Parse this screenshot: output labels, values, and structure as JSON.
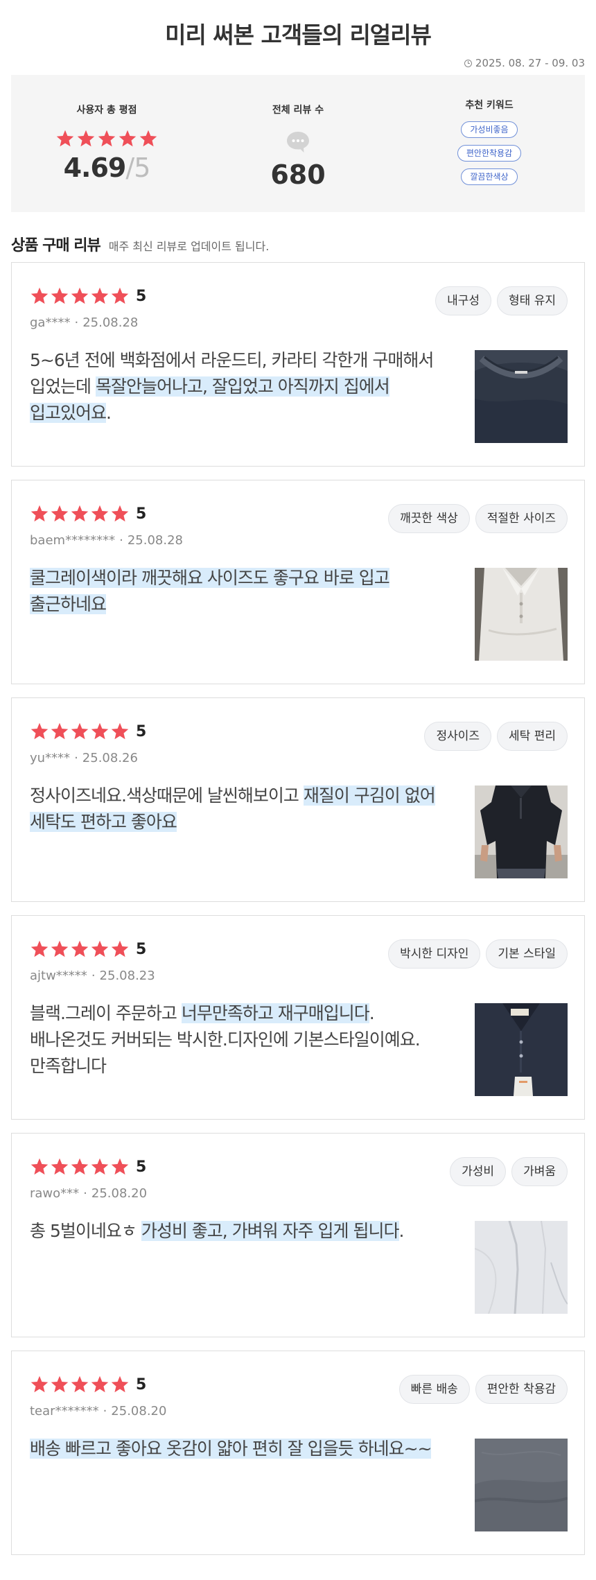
{
  "header": {
    "title": "미리 써본 고객들의 리얼리뷰",
    "period": "2025. 08. 27 - 09. 03"
  },
  "summary": {
    "rating_label": "사용자 총 평점",
    "rating_value": "4.69",
    "rating_slash": "/",
    "rating_max": "5",
    "rating_stars": 5,
    "count_label": "전체 리뷰 수",
    "count_value": "680",
    "keyword_label": "추천 키워드",
    "keywords": [
      "가성비좋음",
      "편안한착용감",
      "깔끔한색상"
    ]
  },
  "section": {
    "title": "상품 구매 리뷰",
    "subtitle": "매주 최신 리뷰로 업데이트 됩니다."
  },
  "colors": {
    "star": "#ef4f58",
    "highlight": "#d9ecfb",
    "keyword": "#3d63c9"
  },
  "reviews": [
    {
      "score": "5",
      "user": "ga****",
      "date": "25.08.28",
      "tags": [
        "내구성",
        "형태 유지"
      ],
      "text_plain": "5~6년 전에 백화점에서 라운드티, 카라티 각한개 구매해서 입었는데 ",
      "text_highlight": "목잘안늘어나고, 잘입었고 아직까지 집에서 입고있어요",
      "text_after": ".",
      "image": "dark-navy-tshirt-closeup"
    },
    {
      "score": "5",
      "user": "baem********",
      "date": "25.08.28",
      "tags": [
        "깨끗한 색상",
        "적절한 사이즈"
      ],
      "text_plain": "",
      "text_highlight": "쿨그레이색이라 깨끗해요 사이즈도 좋구요 바로 입고 출근하네요",
      "text_after": "",
      "image": "light-gray-polo"
    },
    {
      "score": "5",
      "user": "yu****",
      "date": "25.08.26",
      "tags": [
        "정사이즈",
        "세탁 편리"
      ],
      "text_plain": "정사이즈네요.색상때문에 날씬해보이고 ",
      "text_highlight": "재질이 구김이 없어 세탁도 편하고 좋아요",
      "text_after": "",
      "image": "man-wearing-dark-polo"
    },
    {
      "score": "5",
      "user": "ajtw*****",
      "date": "25.08.23",
      "tags": [
        "박시한 디자인",
        "기본 스타일"
      ],
      "text_plain": "블랙.그레이 주문하고 ",
      "text_highlight": "너무만족하고 재구매입니다",
      "text_after": ". 배나온것도 커버되는 박시한.디자인에 기본스타일이예요. 만족합니다",
      "image": "navy-knit-polo"
    },
    {
      "score": "5",
      "user": "rawo***",
      "date": "25.08.20",
      "tags": [
        "가성비",
        "가벼움"
      ],
      "text_plain": "총 5벌이네요ㅎ ",
      "text_highlight": "가성비 좋고, 가벼워 자주 입게 됩니다",
      "text_after": ".",
      "image": "white-polo"
    },
    {
      "score": "5",
      "user": "tear*******",
      "date": "25.08.20",
      "tags": [
        "빠른 배송",
        "편안한 착용감"
      ],
      "text_plain": "",
      "text_highlight": "배송 빠르고 좋아요 옷감이 얇아 편히 잘 입을듯 하네요~~",
      "text_after": "",
      "image": "gray-fabric"
    }
  ]
}
